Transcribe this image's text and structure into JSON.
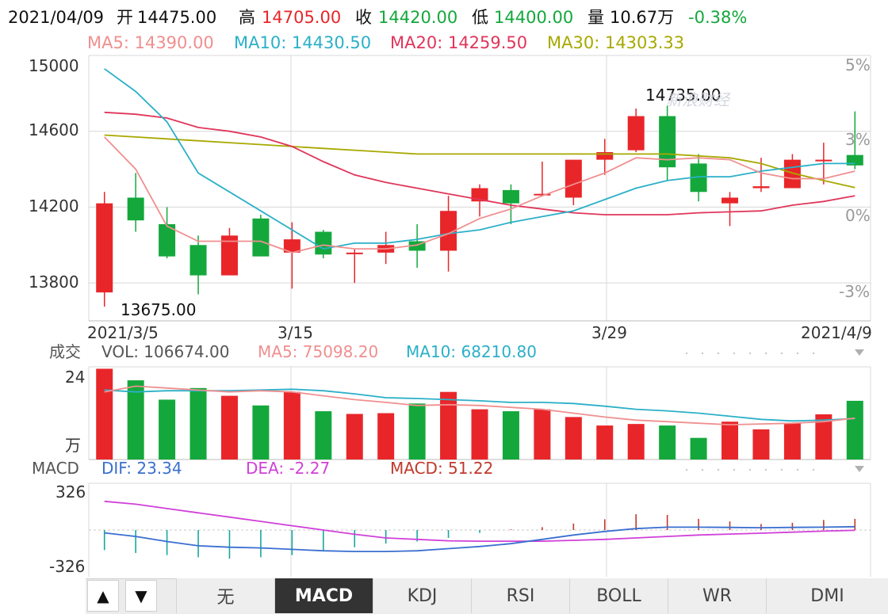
{
  "header": {
    "date": "2021/04/09",
    "open_label": "开",
    "open": "14475.00",
    "high_label": "高",
    "high": "14705.00",
    "close_label": "收",
    "close": "14420.00",
    "low_label": "低",
    "low": "14400.00",
    "volume_label": "量",
    "volume": "10.67万",
    "change": "-0.38%"
  },
  "ma_legend": [
    {
      "label": "MA5: 14390.00",
      "color": "#f08f8f"
    },
    {
      "label": "MA10: 14430.50",
      "color": "#2ab0c8"
    },
    {
      "label": "MA20: 14259.50",
      "color": "#e0355a"
    },
    {
      "label": "MA30: 14303.33",
      "color": "#a8a800"
    }
  ],
  "price_axis": [
    "15000",
    "14600",
    "14200",
    "13800"
  ],
  "pct_axis": [
    "5%",
    "3%",
    "0%",
    "-3%"
  ],
  "date_axis": [
    "2021/3/5",
    "3/15",
    "3/29",
    "2021/4/9"
  ],
  "annotations": {
    "high": "14735.00",
    "low": "13675.00",
    "watermark": "新浪财经"
  },
  "volume_header": {
    "title": "成交",
    "vol": "VOL: 106674.00",
    "ma5": "MA5: 75098.20",
    "ma10": "MA10: 68210.80"
  },
  "volume_axis": {
    "top": "24",
    "unit": "万"
  },
  "macd_header": {
    "title": "MACD",
    "dif": "DIF: 23.34",
    "dea": "DEA: -2.27",
    "macd": "MACD: 51.22"
  },
  "macd_axis": {
    "top": "326",
    "bottom": "-326"
  },
  "controls": {
    "up_icon": "▲",
    "down_icon": "▼"
  },
  "tabs": [
    {
      "label": "无",
      "active": false
    },
    {
      "label": "MACD",
      "active": true
    },
    {
      "label": "KDJ",
      "active": false
    },
    {
      "label": "RSI",
      "active": false
    },
    {
      "label": "BOLL",
      "active": false
    },
    {
      "label": "WR",
      "active": false
    },
    {
      "label": "DMI",
      "active": false
    }
  ],
  "colors": {
    "up": "#e8262a",
    "down": "#14a83c",
    "grid": "#d8d8d8"
  },
  "chart_data": {
    "type": "candlestick",
    "x": [
      "3/5",
      "3/8",
      "3/9",
      "3/10",
      "3/11",
      "3/12",
      "3/15",
      "3/16",
      "3/17",
      "3/18",
      "3/19",
      "3/22",
      "3/23",
      "3/24",
      "3/25",
      "3/26",
      "3/29",
      "3/30",
      "3/31",
      "4/1",
      "4/2",
      "4/6",
      "4/7",
      "4/8",
      "4/9"
    ],
    "ohlc": [
      [
        13750,
        14280,
        13675,
        14220
      ],
      [
        14250,
        14380,
        14070,
        14130
      ],
      [
        14110,
        14200,
        13930,
        13940
      ],
      [
        14000,
        14050,
        13740,
        13840
      ],
      [
        13840,
        14090,
        13840,
        14050
      ],
      [
        14140,
        14160,
        13940,
        13940
      ],
      [
        13960,
        14120,
        13770,
        14030
      ],
      [
        14070,
        14080,
        13930,
        13950
      ],
      [
        13960,
        13980,
        13800,
        13960
      ],
      [
        13960,
        14070,
        13900,
        14000
      ],
      [
        14020,
        14110,
        13880,
        13970
      ],
      [
        13970,
        14260,
        13860,
        14180
      ],
      [
        14230,
        14320,
        14150,
        14300
      ],
      [
        14290,
        14320,
        14110,
        14220
      ],
      [
        14270,
        14440,
        14260,
        14270
      ],
      [
        14250,
        14440,
        14210,
        14450
      ],
      [
        14450,
        14560,
        14370,
        14490
      ],
      [
        14500,
        14720,
        14490,
        14680
      ],
      [
        14680,
        14735,
        14340,
        14410
      ],
      [
        14430,
        14480,
        14230,
        14280
      ],
      [
        14220,
        14280,
        14100,
        14250
      ],
      [
        14300,
        14460,
        14280,
        14310
      ],
      [
        14300,
        14480,
        14300,
        14450
      ],
      [
        14450,
        14540,
        14320,
        14450
      ],
      [
        14475,
        14705,
        14400,
        14420
      ]
    ],
    "price_range": [
      13600,
      15000
    ],
    "ma5": [
      14570,
      14400,
      14100,
      14020,
      14020,
      14020,
      13960,
      14000,
      13980,
      13980,
      14000,
      14060,
      14140,
      14190,
      14260,
      14320,
      14380,
      14460,
      14450,
      14460,
      14450,
      14380,
      14350,
      14350,
      14390
    ],
    "ma10": [
      14930,
      14810,
      14650,
      14380,
      14280,
      14180,
      14080,
      13980,
      14010,
      14010,
      14030,
      14060,
      14080,
      14120,
      14150,
      14180,
      14240,
      14300,
      14340,
      14360,
      14360,
      14390,
      14410,
      14430,
      14430
    ],
    "ma20": [
      14700,
      14690,
      14670,
      14620,
      14600,
      14570,
      14520,
      14440,
      14370,
      14330,
      14300,
      14270,
      14240,
      14210,
      14190,
      14170,
      14160,
      14160,
      14160,
      14170,
      14175,
      14180,
      14210,
      14230,
      14260
    ],
    "ma30": [
      14580,
      14570,
      14560,
      14550,
      14540,
      14530,
      14520,
      14510,
      14500,
      14490,
      14480,
      14480,
      14480,
      14480,
      14480,
      14480,
      14480,
      14480,
      14480,
      14470,
      14460,
      14430,
      14380,
      14340,
      14303
    ],
    "volume": [
      23.5,
      20.5,
      15.5,
      18.5,
      16.5,
      14.0,
      17.5,
      12.5,
      11.8,
      12.0,
      14.5,
      17.5,
      13.0,
      12.5,
      13.0,
      11.0,
      8.8,
      9.2,
      8.8,
      5.6,
      9.8,
      7.8,
      9.4,
      11.7,
      15.2
    ],
    "volume_range": [
      0,
      24
    ],
    "vol_ma5": [
      17.5,
      19.0,
      18.5,
      18.0,
      17.5,
      17.8,
      17.5,
      16.5,
      15.5,
      14.8,
      14.0,
      14.2,
      14.0,
      13.5,
      13.0,
      12.0,
      11.0,
      10.2,
      9.8,
      9.4,
      9.0,
      9.2,
      9.4,
      9.8,
      10.7
    ],
    "vol_ma10": [
      18.0,
      17.5,
      17.8,
      17.8,
      17.8,
      18.0,
      18.2,
      17.8,
      17.0,
      16.0,
      15.8,
      15.5,
      15.2,
      14.8,
      14.8,
      14.5,
      13.8,
      13.0,
      12.6,
      12.0,
      11.2,
      10.4,
      10.0,
      10.2,
      10.6
    ],
    "macd_hist": [
      -140,
      -160,
      -175,
      -190,
      -200,
      -190,
      -175,
      -140,
      -120,
      -95,
      -80,
      -55,
      -20,
      5,
      20,
      45,
      75,
      110,
      105,
      78,
      60,
      42,
      50,
      70,
      78
    ],
    "dif": [
      -20,
      -45,
      -80,
      -110,
      -120,
      -125,
      -135,
      -145,
      -150,
      -150,
      -145,
      -130,
      -115,
      -95,
      -65,
      -35,
      -10,
      10,
      20,
      20,
      18,
      16,
      18,
      20,
      23
    ],
    "dea": [
      200,
      180,
      150,
      120,
      90,
      60,
      30,
      0,
      -30,
      -55,
      -65,
      -75,
      -78,
      -78,
      -78,
      -72,
      -65,
      -55,
      -45,
      -35,
      -28,
      -22,
      -15,
      -8,
      -2
    ],
    "macd_range": [
      -326,
      326
    ]
  }
}
